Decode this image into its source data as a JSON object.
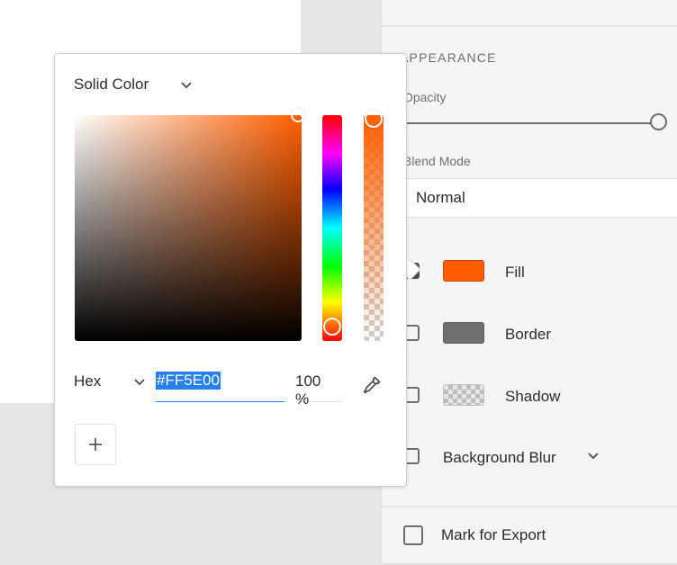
{
  "panel": {
    "appearance_title": "APPEARANCE",
    "opacity_label": "Opacity",
    "opacity_value": 1.0,
    "blend_mode_label": "Blend Mode",
    "blend_mode_value": "Normal",
    "properties": [
      {
        "label": "Fill",
        "checked": true,
        "swatch": "#ff5e00"
      },
      {
        "label": "Border",
        "checked": false,
        "swatch": "#707070"
      },
      {
        "label": "Shadow",
        "checked": false,
        "swatch": "checker"
      },
      {
        "label": "Background Blur",
        "checked": false
      }
    ],
    "export_label": "Mark for Export"
  },
  "picker": {
    "mode": "Solid Color",
    "format": "Hex",
    "hex_value": "#FF5E00",
    "alpha_value": "100 %",
    "current_color": "#ff5e00"
  },
  "icons": {
    "mode_chevron": "chevron-down-icon",
    "format_chevron": "chevron-down-icon",
    "eyedropper": "eyedropper-icon",
    "add": "plus-icon",
    "blur_chevron": "chevron-down-icon"
  }
}
